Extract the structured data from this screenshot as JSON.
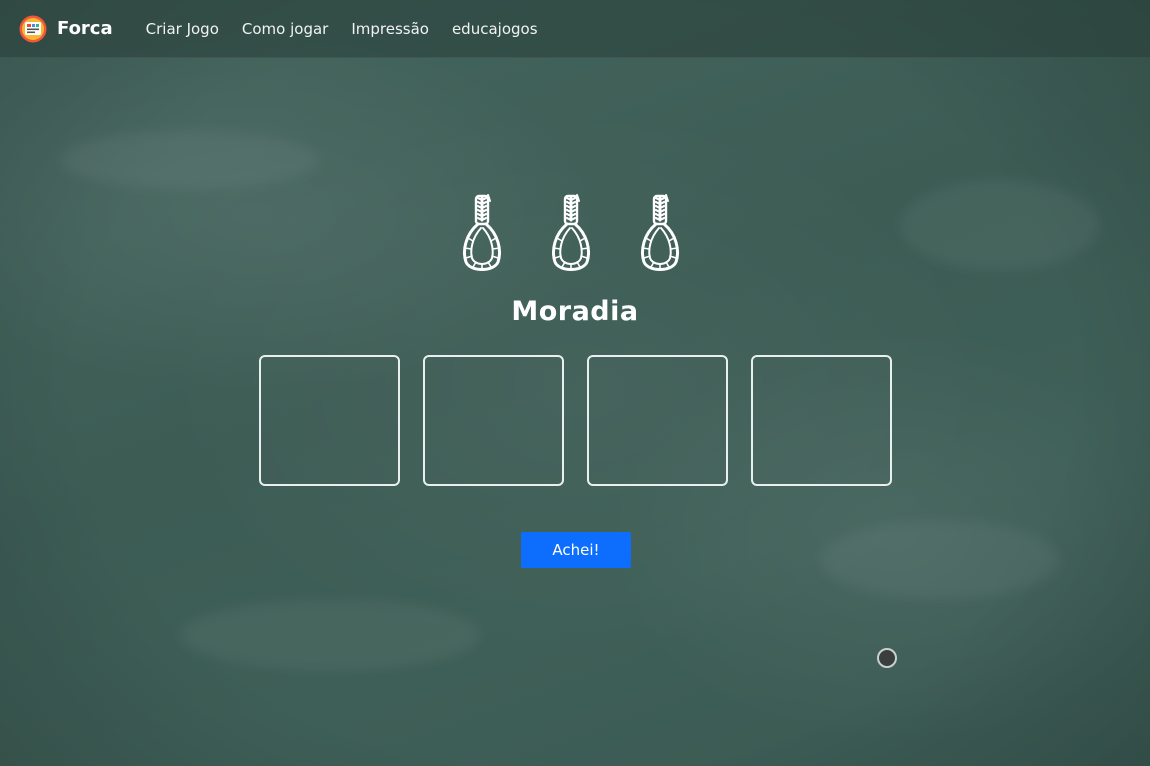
{
  "navbar": {
    "brand_name": "Forca",
    "links": [
      {
        "label": "Criar Jogo"
      },
      {
        "label": "Como jogar"
      },
      {
        "label": "Impressão"
      },
      {
        "label": "educajogos"
      }
    ]
  },
  "game": {
    "lives_remaining": 3,
    "category": "Moradia",
    "letter_slots": [
      "",
      "",
      "",
      ""
    ],
    "submit_label": "Achei!"
  },
  "icons": {
    "brand": "game-logo-icon",
    "life": "noose-icon"
  },
  "colors": {
    "board": "#3f6058",
    "chalk": "#ffffff",
    "button": "#0d6efd"
  }
}
